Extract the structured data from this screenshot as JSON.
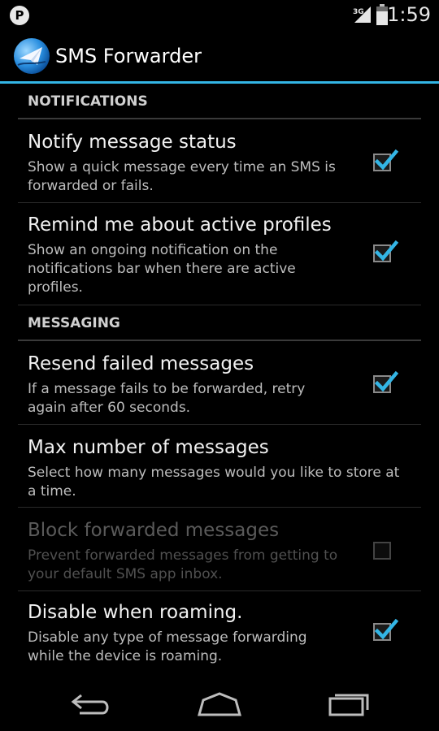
{
  "status_bar": {
    "notification_icon": "P",
    "network_type": "3G",
    "time": "1:59",
    "icons": [
      "parking-notification-icon",
      "signal-3g-icon",
      "battery-icon"
    ]
  },
  "action_bar": {
    "title": "SMS Forwarder",
    "icon": "app-logo-icon",
    "accent_color": "#33b5e5"
  },
  "categories": [
    {
      "title": "NOTIFICATIONS"
    },
    {
      "title": "MESSAGING"
    }
  ],
  "preferences": [
    {
      "title": "Notify message status",
      "summary": "Show a quick message every time an SMS is forwarded or fails.",
      "checked": true,
      "enabled": true
    },
    {
      "title": "Remind me about active profiles",
      "summary": "Show an ongoing notification on the notifications bar when there are active profiles.",
      "checked": true,
      "enabled": true
    },
    {
      "title": "Resend failed messages",
      "summary": "If a message fails to be forwarded, retry again after 60 seconds.",
      "checked": true,
      "enabled": true
    },
    {
      "title": "Max number of messages",
      "summary": "Select how many messages would you like to store at a time.",
      "enabled": true
    },
    {
      "title": "Block forwarded messages",
      "summary": "Prevent forwarded messages from getting to your default SMS app inbox.",
      "checked": false,
      "enabled": false
    },
    {
      "title": "Disable when roaming.",
      "summary": "Disable any type of message forwarding while the device is roaming.",
      "checked": true,
      "enabled": true
    }
  ],
  "nav_bar": {
    "buttons": [
      "back-icon",
      "home-icon",
      "recent-apps-icon"
    ]
  }
}
